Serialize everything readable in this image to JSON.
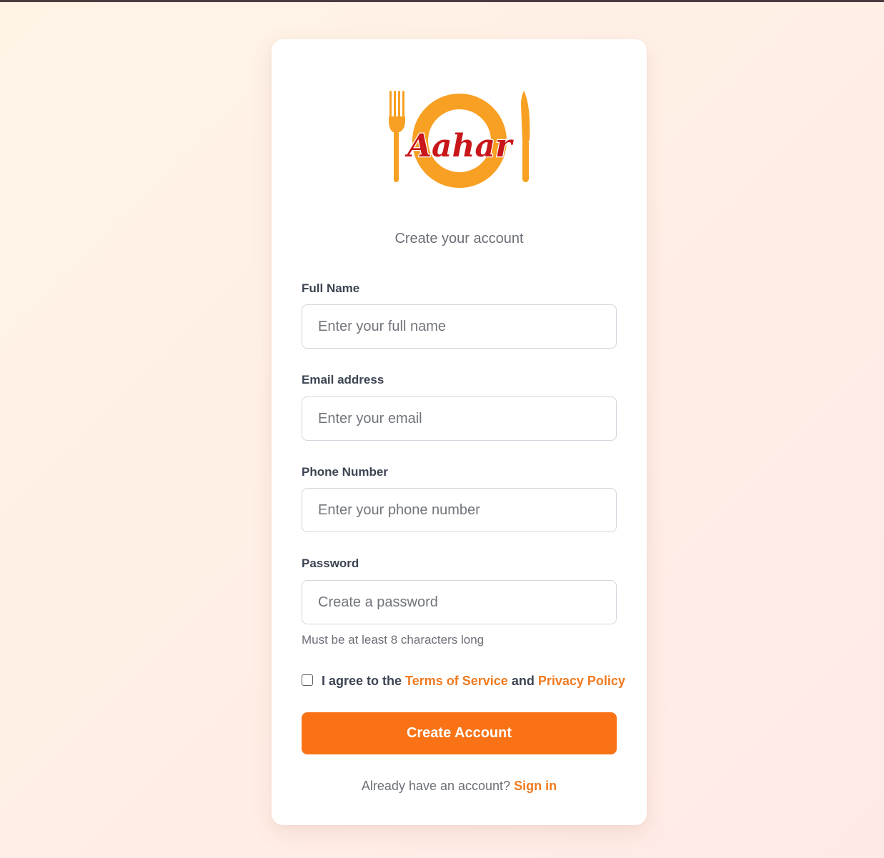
{
  "brand": {
    "name": "Aahar",
    "colors": {
      "accent": "#f97316",
      "plate": "#f8a023",
      "logo_text": "#c8161a"
    }
  },
  "form": {
    "subtitle": "Create your account",
    "fields": [
      {
        "label": "Full Name",
        "placeholder": "Enter your full name",
        "value": ""
      },
      {
        "label": "Email address",
        "placeholder": "Enter your email",
        "value": ""
      },
      {
        "label": "Phone Number",
        "placeholder": "Enter your phone number",
        "value": ""
      },
      {
        "label": "Password",
        "placeholder": "Create a password",
        "value": ""
      }
    ],
    "password_hint": "Must be at least 8 characters long",
    "agreement": {
      "checked": false,
      "prefix": "I agree to the",
      "terms_link": "Terms of Service",
      "conjunction": "and",
      "privacy_link": "Privacy Policy"
    },
    "submit_label": "Create Account",
    "signin_prompt": "Already have an account?",
    "signin_link": "Sign in"
  }
}
